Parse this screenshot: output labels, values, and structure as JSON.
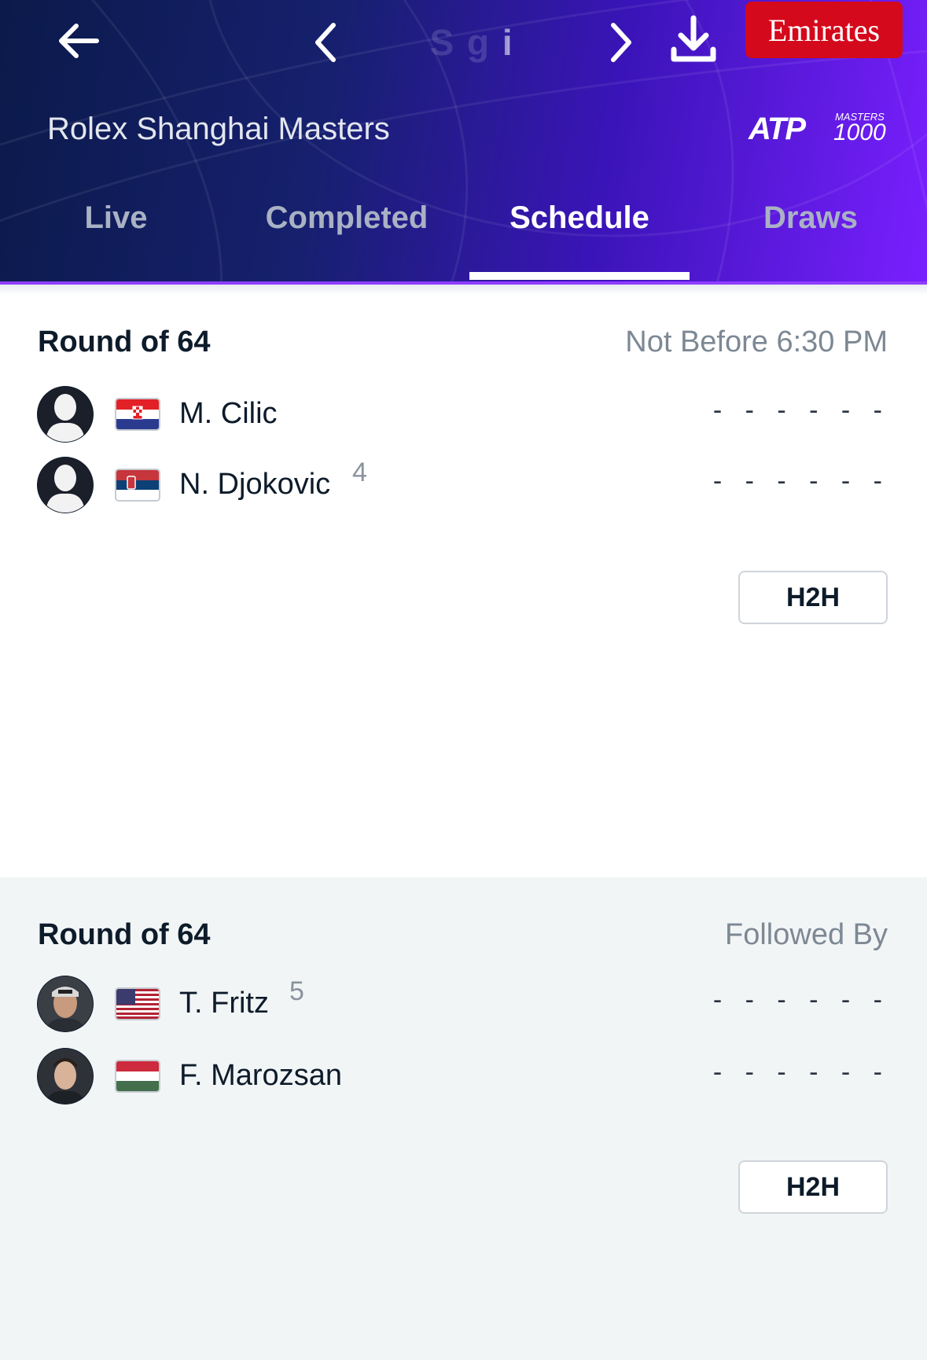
{
  "header": {
    "date_title": "S  g  i",
    "sponsor": "Emirates",
    "tournament": "Rolex Shanghai Masters",
    "logo_text": "ATP",
    "logo_super": "MASTERS",
    "logo_number": "1000"
  },
  "tabs": [
    {
      "label": "Live"
    },
    {
      "label": "Completed"
    },
    {
      "label": "Schedule"
    },
    {
      "label": "Draws"
    }
  ],
  "matches": [
    {
      "round": "Round of 64",
      "time": "Not Before 6:30 PM",
      "players": [
        {
          "name": "M. Cilic",
          "seed": "",
          "score": "- - - - - -",
          "country": "Croatia"
        },
        {
          "name": "N. Djokovic",
          "seed": "4",
          "score": "- - - - - -",
          "country": "Serbia"
        }
      ],
      "h2h_label": "H2H"
    },
    {
      "round": "Round of 64",
      "time": "Followed By",
      "players": [
        {
          "name": "T. Fritz",
          "seed": "5",
          "score": "- - - - - -",
          "country": "United States"
        },
        {
          "name": "F. Marozsan",
          "seed": "",
          "score": "- - - - - -",
          "country": "Hungary"
        }
      ],
      "h2h_label": "H2H"
    }
  ],
  "colors": {
    "header_start": "#0b1a4a",
    "header_end": "#7a1fff",
    "sponsor_red": "#d4091b",
    "tab_active": "#ffffff",
    "tab_inactive": "#a9b1c4"
  },
  "icons": [
    "back-arrow-icon",
    "chevron-left-icon",
    "chevron-right-icon",
    "download-icon",
    "player-silhouette-icon"
  ]
}
